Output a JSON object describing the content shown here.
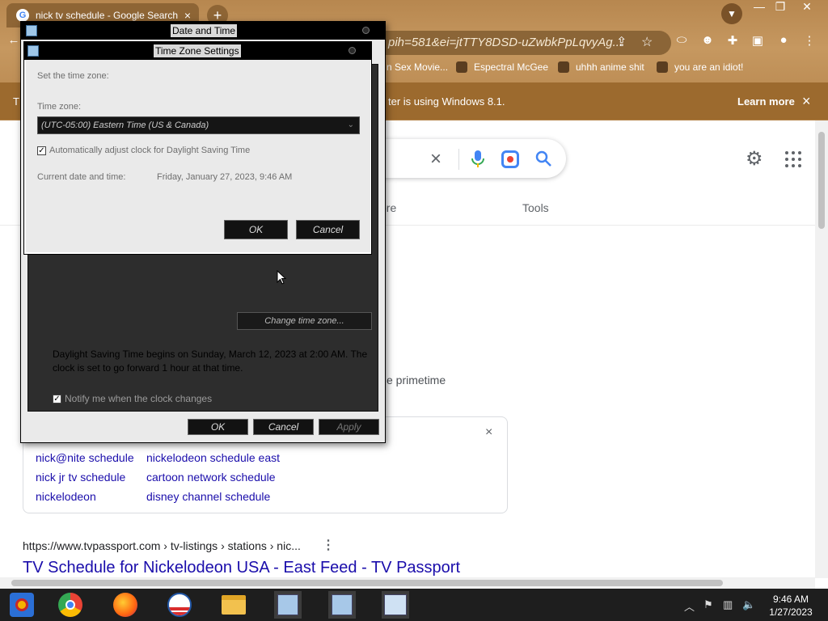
{
  "browser": {
    "tab_title": "nick tv schedule - Google Search",
    "tab_close": "×",
    "new_tab": "+",
    "url_fragment": "pih=581&ei=jtTTY8DSD-uZwbkPpLqvyAg...",
    "bookmarks": [
      "n Sex Movie...",
      "Espectral McGee",
      "uhhh anime shit",
      "you are an idiot!"
    ],
    "infobar_left": "T",
    "infobar_text": "ter is using Windows 8.1.",
    "learn_more": "Learn more",
    "infobar_close": "×"
  },
  "google": {
    "clear": "×",
    "nav_more": "ore",
    "nav_tools": "Tools",
    "primetime": "e primetime",
    "related_close": "×",
    "related": [
      "nick@nite schedule",
      "nickelodeon schedule east",
      "nick jr tv schedule",
      "cartoon network schedule",
      "nickelodeon",
      "disney channel schedule"
    ],
    "cite": "https://www.tvpassport.com › tv-listings › stations › nic...",
    "cite_menu": "⋮",
    "result_title": "TV Schedule for Nickelodeon USA - East Feed - TV Passport"
  },
  "date_time": {
    "title": "Date and Time",
    "change_tz": "Change time zone...",
    "dst_text": "Daylight Saving Time begins on Sunday, March 12, 2023 at 2:00 AM. The clock is set to go forward 1 hour at that time.",
    "notify_label": "Notify me when the clock changes",
    "notify_checked": true,
    "ok": "OK",
    "cancel": "Cancel",
    "apply": "Apply"
  },
  "tz_settings": {
    "title": "Time Zone Settings",
    "set_label": "Set the time zone:",
    "tz_label": "Time zone:",
    "tz_value": "(UTC-05:00) Eastern Time (US & Canada)",
    "auto_adjust": "Automatically adjust clock for Daylight Saving Time",
    "auto_adjust_checked": true,
    "current_label": "Current date and time:",
    "current_value": "Friday, January 27, 2023, 9:46 AM",
    "ok": "OK",
    "cancel": "Cancel"
  },
  "taskbar": {
    "time": "9:46 AM",
    "date": "1/27/2023",
    "apps": [
      "start-icon",
      "chrome-icon",
      "firefox-icon",
      "obama-logo-icon",
      "file-explorer-icon",
      "network-setup-icon",
      "network-setup-icon",
      "date-time-icon"
    ]
  },
  "colors": {
    "chrome_frame": "#b7874f",
    "infobar": "#9c6a2e",
    "link": "#1a0dab",
    "dialog_title_bg": "#000000",
    "dialog_body": "#eaeaea"
  }
}
